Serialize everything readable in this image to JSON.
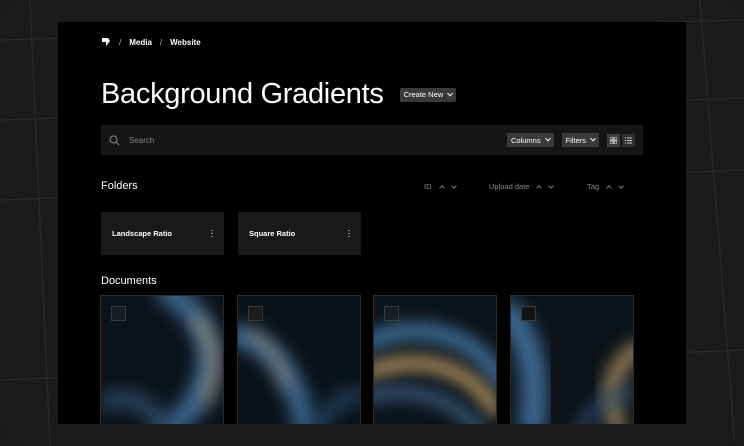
{
  "breadcrumb": {
    "items": [
      "Media",
      "Website"
    ],
    "separator": "/"
  },
  "header": {
    "title": "Background Gradients",
    "create_label": "Create New"
  },
  "search": {
    "placeholder": "Search"
  },
  "toolbar": {
    "columns_label": "Columns",
    "filters_label": "Filters"
  },
  "folders": {
    "title": "Folders",
    "sort": {
      "id": "ID",
      "upload_date": "Upload date",
      "tag": "Tag"
    },
    "items": [
      {
        "label": "Landscape Ratio"
      },
      {
        "label": "Square Ratio"
      }
    ]
  },
  "documents": {
    "title": "Documents",
    "count_visible": 4
  },
  "colors": {
    "accent_blue": "#3e6a94",
    "accent_gold": "#c9a46a",
    "app_bg": "#000000",
    "frame_bg": "#1b1b1b"
  },
  "icons": [
    "logo-icon",
    "search-icon",
    "chevron-down-icon",
    "grid-view-icon",
    "list-view-icon",
    "more-vertical-icon",
    "sort-up-icon",
    "sort-down-icon"
  ]
}
